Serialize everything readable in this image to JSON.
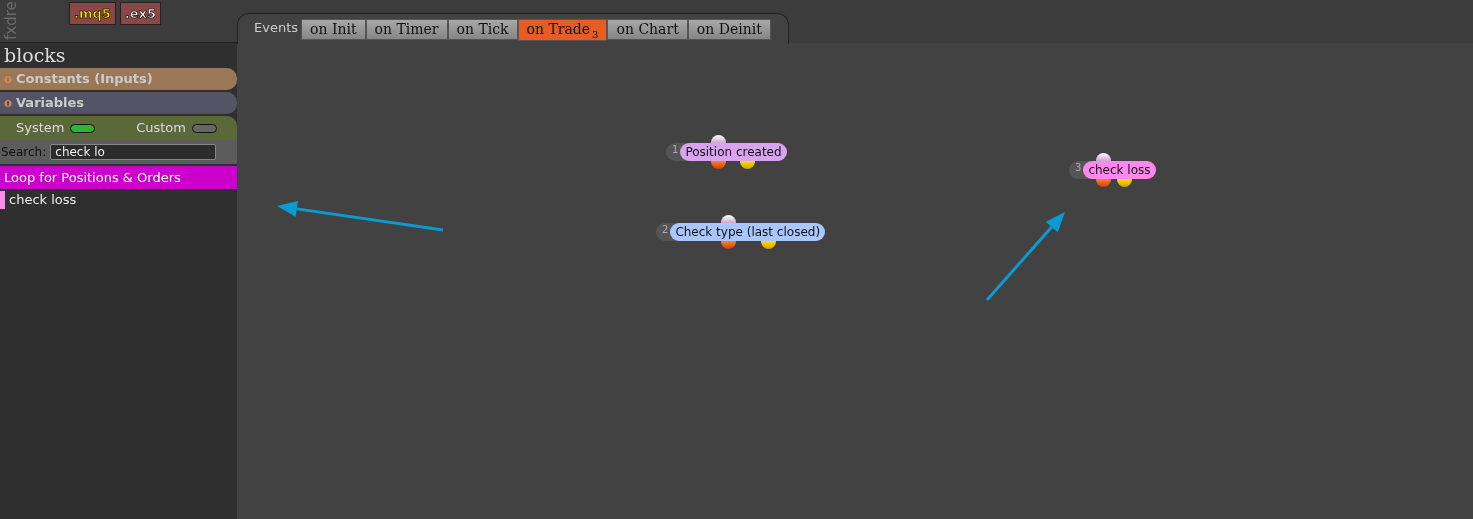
{
  "brand": "fxdre",
  "file_buttons": [
    {
      "label": ".mq5",
      "kind": "source"
    },
    {
      "label": ".ex5",
      "kind": "compiled"
    }
  ],
  "sidebar": {
    "title": "blocks",
    "sections": [
      {
        "label": "Constants (Inputs)",
        "icon": "o",
        "kind": "constants"
      },
      {
        "label": "Variables",
        "icon": "o",
        "kind": "variables"
      }
    ],
    "toggles": [
      {
        "label": "System",
        "on": true
      },
      {
        "label": "Custom",
        "on": false
      }
    ],
    "search": {
      "label": "Search:",
      "value": "check lo"
    },
    "categories": [
      {
        "label": "Loop for Positions & Orders",
        "color": "#cc00cc",
        "items": [
          {
            "label": "check loss",
            "color": "#ff88ee"
          }
        ]
      }
    ]
  },
  "events": {
    "label": "Events",
    "tabs": [
      {
        "label": "on Init",
        "selected": false
      },
      {
        "label": "on Timer",
        "selected": false
      },
      {
        "label": "on Tick",
        "selected": false
      },
      {
        "label": "on Trade",
        "selected": true,
        "count": "3"
      },
      {
        "label": "on Chart",
        "selected": false
      },
      {
        "label": "on Deinit",
        "selected": false
      }
    ]
  },
  "nodes": [
    {
      "number": "1",
      "label": "Position created",
      "color": "#d9a3f2"
    },
    {
      "number": "2",
      "label": "Check type (last closed)",
      "color": "#a9c6ff"
    },
    {
      "number": "3",
      "label": "check loss",
      "color": "#ff88ee"
    }
  ]
}
